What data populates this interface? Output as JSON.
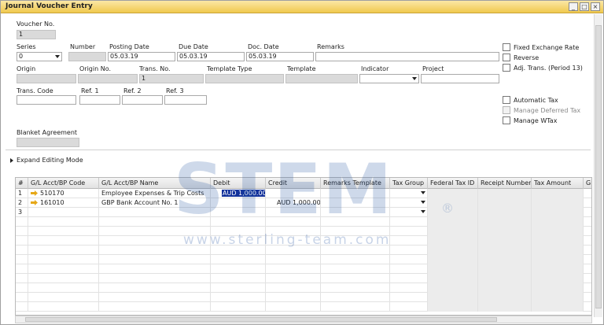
{
  "window": {
    "title": "Journal Voucher Entry",
    "controls": [
      "_",
      "□",
      "×"
    ]
  },
  "header": {
    "voucher_no": {
      "label": "Voucher No.",
      "value": "1"
    },
    "series": {
      "label": "Series",
      "value": "0"
    },
    "number": {
      "label": "Number",
      "value": ""
    },
    "posting_date": {
      "label": "Posting Date",
      "value": "05.03.19"
    },
    "due_date": {
      "label": "Due Date",
      "value": "05.03.19"
    },
    "doc_date": {
      "label": "Doc. Date",
      "value": "05.03.19"
    },
    "remarks": {
      "label": "Remarks",
      "value": ""
    },
    "origin": {
      "label": "Origin",
      "value": ""
    },
    "origin_no": {
      "label": "Origin No.",
      "value": ""
    },
    "trans_no": {
      "label": "Trans. No.",
      "value": "1"
    },
    "template_type": {
      "label": "Template Type",
      "value": ""
    },
    "template": {
      "label": "Template",
      "value": ""
    },
    "indicator": {
      "label": "Indicator",
      "value": ""
    },
    "project": {
      "label": "Project",
      "value": ""
    },
    "trans_code": {
      "label": "Trans. Code",
      "value": ""
    },
    "ref1": {
      "label": "Ref. 1",
      "value": ""
    },
    "ref2": {
      "label": "Ref. 2",
      "value": ""
    },
    "ref3": {
      "label": "Ref. 3",
      "value": ""
    },
    "blanket_agreement": {
      "label": "Blanket Agreement",
      "value": ""
    }
  },
  "options": {
    "fixed_exchange_rate": "Fixed Exchange Rate",
    "reverse": "Reverse",
    "adj_trans": "Adj. Trans. (Period 13)",
    "automatic_tax": "Automatic Tax",
    "manage_deferred_tax": "Manage Deferred Tax",
    "manage_wtax": "Manage WTax"
  },
  "expand_editing_mode": "Expand Editing Mode",
  "grid": {
    "columns": [
      "#",
      "G/L Acct/BP Code",
      "G/L Acct/BP Name",
      "Debit",
      "Credit",
      "Remarks Template",
      "Tax Group",
      "Federal Tax ID",
      "Receipt Number",
      "Tax Amount",
      "Gr"
    ],
    "rows": [
      {
        "num": "1",
        "code": "510170",
        "name": "Employee Expenses & Trip Costs",
        "debit": "AUD 1,000.00",
        "credit": ""
      },
      {
        "num": "2",
        "code": "161010",
        "name": "GBP Bank Account No. 1",
        "debit": "",
        "credit": "AUD 1,000.00"
      },
      {
        "num": "3",
        "code": "",
        "name": "",
        "debit": "",
        "credit": ""
      }
    ]
  },
  "watermark": {
    "logo": "STEM",
    "registered": "®",
    "url": "www.sterling-team.com"
  },
  "colors": {
    "titlebar": "#f0c94e",
    "selection": "#13329b",
    "arrow": "#e6a817"
  }
}
